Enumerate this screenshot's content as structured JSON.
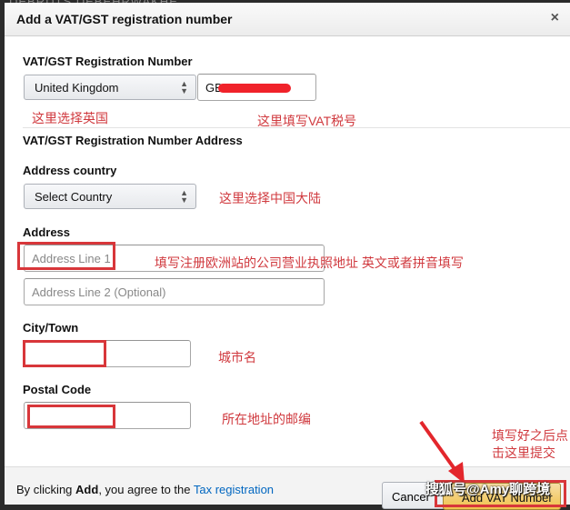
{
  "background_text": "DEBRDTS   DEBEHRWAKHE",
  "dialog": {
    "title": "Add a VAT/GST registration number",
    "close_label": "×"
  },
  "vat_section": {
    "label": "VAT/GST Registration Number",
    "country_select_value": "United Kingdom",
    "vat_number_value": "GB"
  },
  "address_section": {
    "heading": "VAT/GST Registration Number Address",
    "country_label": "Address country",
    "country_select_value": "Select Country",
    "address_label": "Address",
    "address_line1_placeholder": "Address Line 1",
    "address_line2_placeholder": "Address Line 2 (Optional)",
    "city_label": "City/Town",
    "city_value": "",
    "postal_label": "Postal Code",
    "postal_value": ""
  },
  "annotations": {
    "select_uk": "这里选择英国",
    "enter_vat": "这里填写VAT税号",
    "select_china": "这里选择中国大陆",
    "address_hint": "填写注册欧洲站的公司营业执照地址 英文或者拼音填写",
    "city_hint": "城市名",
    "postal_hint": "所在地址的邮编",
    "submit_hint": "填写好之后点击这里提交"
  },
  "footer": {
    "text_prefix": "By clicking ",
    "text_bold": "Add",
    "text_middle": ", you agree to the ",
    "link_text": "Tax registration",
    "cancel_label": "Cancel",
    "add_label": "Add VAT Number"
  },
  "watermark": "搜狐号@Amy聊跨境"
}
